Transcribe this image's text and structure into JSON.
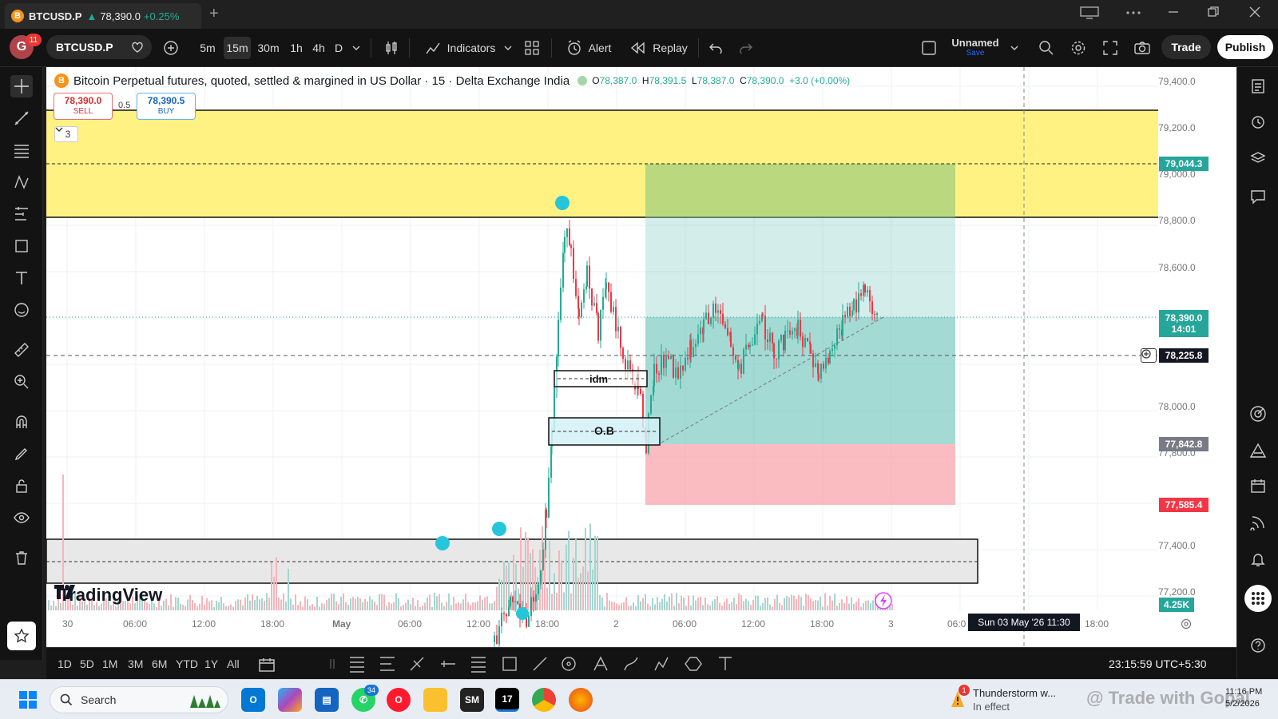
{
  "browser": {
    "tab": {
      "symbol": "BTCUSD.P",
      "arrow": "▲",
      "price": "78,390.0",
      "change": "+0.25%"
    },
    "new_tab": "+"
  },
  "toolbar": {
    "avatar_letter": "G",
    "avatar_badge": "11",
    "symbol": "BTCUSD.P",
    "intervals": [
      "5m",
      "15m",
      "30m",
      "1h",
      "4h",
      "D"
    ],
    "active_interval": "15m",
    "indicators": "Indicators",
    "alert": "Alert",
    "replay": "Replay",
    "layout_name": "Unnamed",
    "layout_save": "Save",
    "trade": "Trade",
    "publish": "Publish"
  },
  "legend": {
    "coin_glyph": "B",
    "title": "Bitcoin Perpetual futures, quoted, settled & margined in US Dollar · 15 · Delta Exchange India",
    "o_label": "O",
    "o": "78,387.0",
    "h_label": "H",
    "h": "78,391.5",
    "l_label": "L",
    "l": "78,387.0",
    "c_label": "C",
    "c": "78,390.0",
    "change": "+3.0 (+0.00%)"
  },
  "order": {
    "sell_price": "78,390.0",
    "sell_label": "SELL",
    "spread": "0.5",
    "buy_price": "78,390.5",
    "buy_label": "BUY",
    "collapse_count": "3"
  },
  "price_axis": {
    "labels": [
      "79,400.0",
      "79,200.0",
      "79,000.0",
      "78,800.0",
      "78,600.0",
      "78,000.0",
      "77,800.0",
      "77,400.0",
      "77,200.0"
    ],
    "tags": {
      "target": "79,044.3",
      "current": "78,390.0",
      "countdown": "14:01",
      "crosshair": "78,225.8",
      "entry": "77,842.8",
      "stop": "77,585.4",
      "volume": "4.25K"
    }
  },
  "time_axis": {
    "labels": [
      "30",
      "06:00",
      "12:00",
      "18:00",
      "May",
      "06:00",
      "12:00",
      "18:00",
      "2",
      "06:00",
      "12:00",
      "18:00",
      "3",
      "06:0",
      "18:00"
    ],
    "crosshair_date": "Sun 03 May '26   11:30"
  },
  "annotations": {
    "idm": "idm",
    "ob": "O.B"
  },
  "logo": {
    "text": "TradingView"
  },
  "bottom": {
    "ranges": [
      "1D",
      "5D",
      "1M",
      "3M",
      "6M",
      "YTD",
      "1Y",
      "All"
    ],
    "clock": "23:15:59 UTC+5:30"
  },
  "taskbar": {
    "search": "Search",
    "whatsapp_badge": "34",
    "weather_badge": "1",
    "weather_title": "Thunderstorm w...",
    "weather_sub": "In effect",
    "watermark": "@ Trade with Gopal",
    "time": "11:16 PM",
    "date": "5/2/2026"
  },
  "colors": {
    "up": "#22ab94",
    "down": "#f23645",
    "supply_zone": "#fff176",
    "target_zone": "#80cbc4",
    "stop_zone": "#f8a5ac"
  },
  "chart_data": {
    "type": "candlestick",
    "y_axis_ticks": [
      79400,
      79200,
      79000,
      78800,
      78600,
      78000,
      77800,
      77400,
      77200
    ],
    "current_price": 78390.0,
    "levels": {
      "target": 79044.3,
      "crosshair": 78225.8,
      "entry": 77842.8,
      "stop": 77585.4
    }
  }
}
